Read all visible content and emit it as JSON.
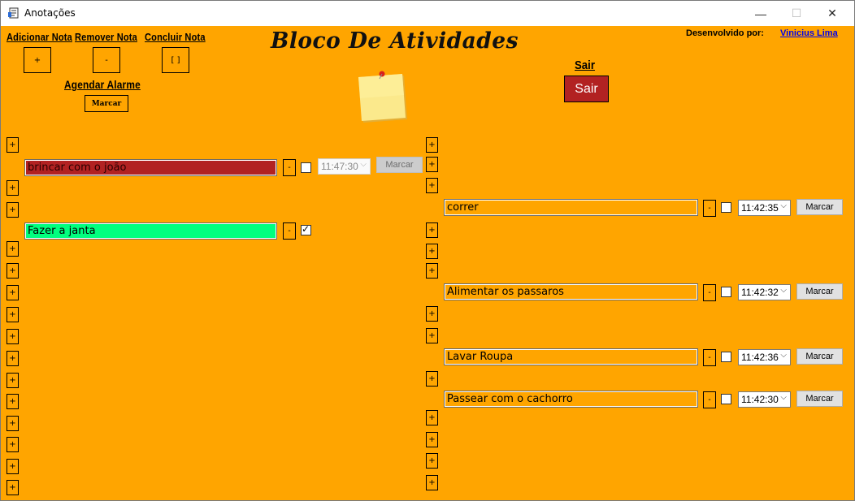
{
  "window": {
    "title": "Anotações",
    "minimize_glyph": "—",
    "maximize_glyph": "☐",
    "close_glyph": "✕"
  },
  "toolbar": {
    "add_label": "Adicionar Nota",
    "add_symbol": "+",
    "remove_label": "Remover Nota",
    "remove_symbol": "-",
    "complete_label": "Concluir Nota",
    "complete_symbol": "[ ]",
    "alarm_label": "Agendar Alarme",
    "alarm_button": "Marcar"
  },
  "header": {
    "title": "Bloco De Atividades",
    "developer_label": "Desenvolvido por:",
    "developer_link": "Vinicius Lima"
  },
  "exit": {
    "label": "Sair",
    "button": "Sair"
  },
  "notes_left": [
    {
      "text": "brincar com o joão",
      "bg": "#b22222",
      "minus": "-",
      "checked": false,
      "time": "11:47:30",
      "button": "Marcar",
      "time_disabled": true
    },
    {
      "text": "Fazer a janta",
      "bg": "#00ff7f",
      "minus": "-",
      "checked": true
    }
  ],
  "notes_right": [
    {
      "text": "correr",
      "minus": "-",
      "checked": false,
      "time": "11:42:35",
      "button": "Marcar"
    },
    {
      "text": "Alimentar os passaros",
      "minus": "-",
      "checked": false,
      "time": "11:42:32",
      "button": "Marcar"
    },
    {
      "text": "Lavar Roupa",
      "minus": "-",
      "checked": false,
      "time": "11:42:36",
      "button": "Marcar"
    },
    {
      "text": "Passear com o cachorro",
      "minus": "-",
      "checked": false,
      "time": "11:42:30",
      "button": "Marcar"
    }
  ],
  "plus_symbol": "+",
  "dropdown_glyph": "⌵",
  "colors": {
    "background": "#ffa500",
    "sair_button": "#b22222",
    "note_field": "#ffa500",
    "link": "#0000ee"
  }
}
